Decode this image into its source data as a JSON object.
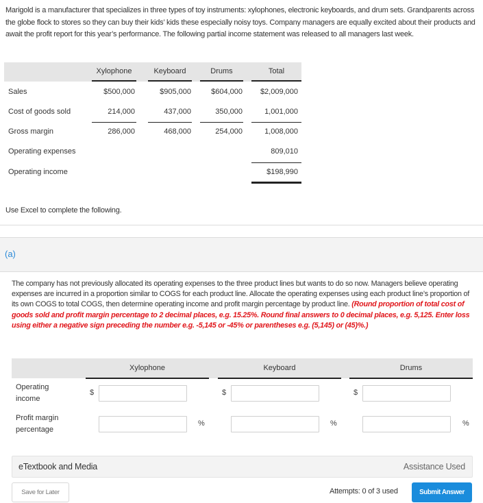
{
  "intro_text": "Marigold is a manufacturer that specializes in three types of toy instruments: xylophones, electronic keyboards, and drum sets. Grandparents across the globe flock to stores so they can buy their kids’ kids these especially noisy toys. Company managers are equally excited about their products and await the profit report for this year’s performance. The following partial income statement was released to all managers last week.",
  "income_statement": {
    "columns": [
      "Xylophone",
      "Keyboard",
      "Drums",
      "Total"
    ],
    "rows": [
      {
        "label": "Sales",
        "values": [
          "$500,000",
          "$905,000",
          "$604,000",
          "$2,009,000"
        ]
      },
      {
        "label": "Cost of goods sold",
        "values": [
          "214,000",
          "437,000",
          "350,000",
          "1,001,000"
        ]
      },
      {
        "label": "Gross margin",
        "values": [
          "286,000",
          "468,000",
          "254,000",
          "1,008,000"
        ]
      },
      {
        "label": "Operating expenses",
        "values": [
          "",
          "",
          "",
          "809,010"
        ]
      },
      {
        "label": "Operating income",
        "values": [
          "",
          "",
          "",
          "$198,990"
        ]
      }
    ]
  },
  "excel_note": "Use Excel to complete the following.",
  "part_label": "(a)",
  "question": {
    "text": "The company has not previously allocated its operating expenses to the three product lines but wants to do so now. Managers believe operating expenses are incurred in a proportion similar to COGS for each product line. Allocate the operating expenses using each product line’s proportion of its own COGS to total COGS, then determine operating income and profit margin percentage by product line.",
    "instructions": "(Round proportion of total cost of goods sold and profit margin percentage to 2 decimal places, e.g. 15.25%. Round final answers to 0 decimal places, e.g. 5,125. Enter loss using either a negative sign preceding the number e.g. -5,145 or -45% or parentheses e.g. (5,145) or (45)%.)"
  },
  "answer_grid": {
    "columns": [
      "Xylophone",
      "Keyboard",
      "Drums"
    ],
    "rows": [
      {
        "label_line1": "Operating",
        "label_line2": "income",
        "prefix": "$",
        "suffix": "",
        "values": [
          "",
          "",
          ""
        ]
      },
      {
        "label_line1": "Profit margin",
        "label_line2": "percentage",
        "prefix": "",
        "suffix": "%",
        "values": [
          "",
          "",
          ""
        ]
      }
    ]
  },
  "footer": {
    "etextbook_label": "eTextbook and Media",
    "assistance_label": "Assistance Used",
    "save_label": "Save for Later",
    "attempts_label": "Attempts: 0 of 3 used",
    "submit_label": "Submit Answer"
  },
  "colors": {
    "accent": "#1a8cdc",
    "part_label": "#2b8ad8",
    "instruction_red": "#e0161b"
  }
}
